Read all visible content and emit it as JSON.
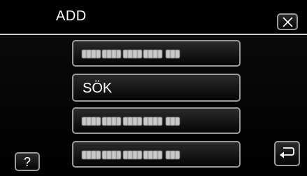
{
  "header": {
    "title": "ADD"
  },
  "list": {
    "items": [
      {
        "label": "",
        "obscured": true
      },
      {
        "label": "SÖK",
        "obscured": false
      },
      {
        "label": "",
        "obscured": true
      },
      {
        "label": "",
        "obscured": true
      }
    ]
  },
  "help": {
    "label": "?"
  },
  "icons": {
    "close": "close-icon",
    "back": "back-return-icon"
  },
  "colors": {
    "background": "#000000",
    "button_border": "#9a9a9a",
    "text": "#ffffff"
  }
}
